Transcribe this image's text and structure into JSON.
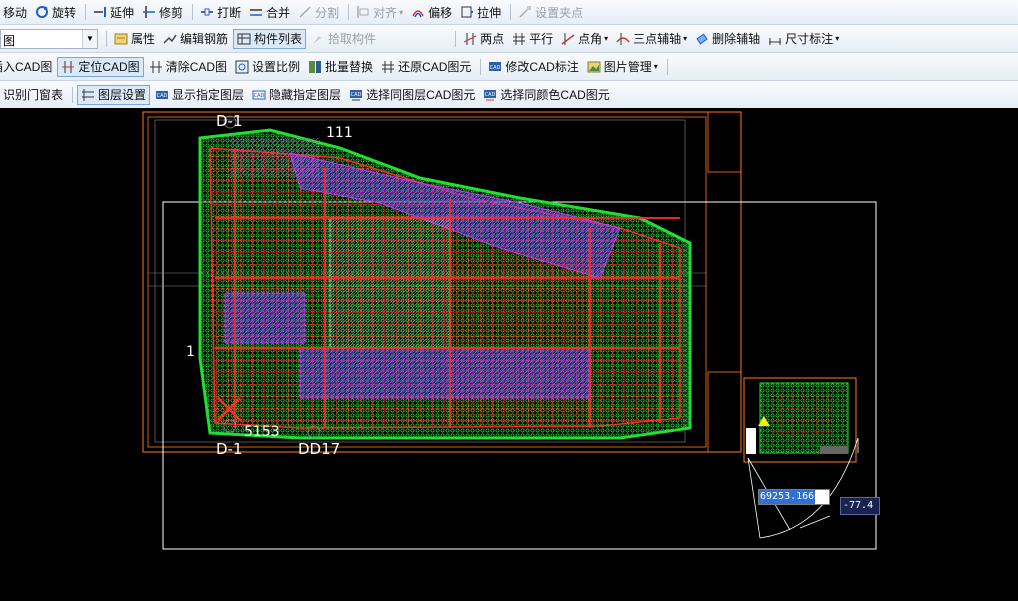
{
  "toolbar1": {
    "move": "移动",
    "rotate": "旋转",
    "extend": "延伸",
    "trim": "修剪",
    "break": "打断",
    "merge": "合并",
    "split": "分割",
    "align": "对齐",
    "offset": "偏移",
    "stretch": "拉伸",
    "set_grip": "设置夹点"
  },
  "toolbar2": {
    "combo_value": "图",
    "properties": "属性",
    "edit_rebar": "编辑钢筋",
    "component_list": "构件列表",
    "pick_component": "拾取构件",
    "two_points": "两点",
    "parallel": "平行",
    "point_angle": "点角",
    "three_point_axis": "三点辅轴",
    "delete_axis": "删除辅轴",
    "dimension": "尺寸标注"
  },
  "toolbar3": {
    "insert_cad": "插入CAD图",
    "locate_cad": "定位CAD图",
    "clear_cad": "清除CAD图",
    "set_scale": "设置比例",
    "batch_replace": "批量替换",
    "restore_cad": "还原CAD图元",
    "modify_cad_label": "修改CAD标注",
    "image_manage": "图片管理"
  },
  "toolbar4": {
    "identify_door_window": "识别门窗表",
    "layer_settings": "图层设置",
    "show_layer": "显示指定图层",
    "hide_layer": "隐藏指定图层",
    "select_same_layer": "选择同图层CAD图元",
    "select_same_color": "选择同颜色CAD图元"
  },
  "canvas": {
    "coord_value": "69253.166",
    "angle_value": "-77.4",
    "labels": [
      "D-1",
      "D-1",
      "DD17",
      "5153",
      "1",
      "111"
    ]
  },
  "colors": {
    "background": "#000000",
    "toolbar_bg": "#eef2f8",
    "cad_red": "#ff2a2a",
    "cad_green": "#22dd33",
    "cad_magenta": "#cc33ff",
    "cad_blue": "#3344ff",
    "cad_orange": "#ff7a1a",
    "cad_white": "#ffffff"
  }
}
